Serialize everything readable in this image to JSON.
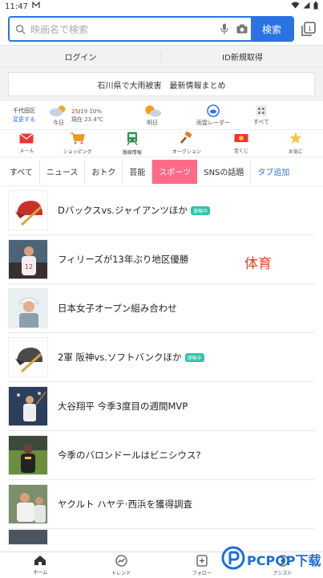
{
  "status_bar": {
    "time": "11:47",
    "sim_icon": "M"
  },
  "search": {
    "placeholder": "映画名で検索",
    "button_label": "検索",
    "tab_count": "1"
  },
  "auth": {
    "login": "ログイン",
    "register": "ID新規取得"
  },
  "banner": {
    "text": "石川県で大雨被害　最新情報まとめ"
  },
  "weather": {
    "city": "千代田区",
    "change": "変更する",
    "today_label": "今日",
    "today_high": "25",
    "today_low": "19",
    "today_precip": "10",
    "today_current": "現在 23.4",
    "today_unit": "℃",
    "tomorrow_label": "明日",
    "radar_label": "雨雲レーダー",
    "all_label": "すべて"
  },
  "services": [
    {
      "label": "メール",
      "icon": "mail-icon"
    },
    {
      "label": "ショッピング",
      "icon": "shopping-cart-icon"
    },
    {
      "label": "路線情報",
      "icon": "train-icon"
    },
    {
      "label": "オークション",
      "icon": "gavel-icon"
    },
    {
      "label": "宝くじ",
      "icon": "lottery-icon"
    },
    {
      "label": "お気に",
      "icon": "star-icon"
    }
  ],
  "category_tabs": [
    {
      "label": "すべて"
    },
    {
      "label": "ニュース"
    },
    {
      "label": "おトク"
    },
    {
      "label": "芸能"
    },
    {
      "label": "スポーツ",
      "active": true
    },
    {
      "label": "SNSの話題"
    },
    {
      "label": "タブ追加"
    }
  ],
  "articles": [
    {
      "title": "Dバックスvs.ジャイアンツほか",
      "badge": "速報中",
      "thumb": "baseball-helmet-red"
    },
    {
      "title": "フィリーズが13年ぶり地区優勝",
      "thumb": "photo-baseball-player"
    },
    {
      "title": "日本女子オープン組み合わせ",
      "thumb": "photo-golfer"
    },
    {
      "title": "2軍 阪神vs.ソフトバンクほか",
      "badge": "速報中",
      "thumb": "baseball-helmet-dark"
    },
    {
      "title": "大谷翔平 今季3度目の週間MVP",
      "thumb": "photo-baseball-batter"
    },
    {
      "title": "今季のバロンドールはビニシウス?",
      "thumb": "photo-soccer-player"
    },
    {
      "title": "ヤクルト ハヤテ·西浜を獲得調査",
      "thumb": "photo-baseball-team"
    }
  ],
  "overlay_label": "体育",
  "bottom_nav": [
    {
      "label": "ホーム",
      "icon": "home-icon"
    },
    {
      "label": "トレンド",
      "icon": "trend-icon"
    },
    {
      "label": "フォロー",
      "icon": "follow-icon"
    },
    {
      "label": "アシスト",
      "icon": "assist-icon"
    }
  ],
  "watermark": {
    "text": "PCPOP下载"
  },
  "colors": {
    "accent": "#2b72e5",
    "sports_tab": "#ff6a88",
    "badge": "#2ec3a9"
  }
}
